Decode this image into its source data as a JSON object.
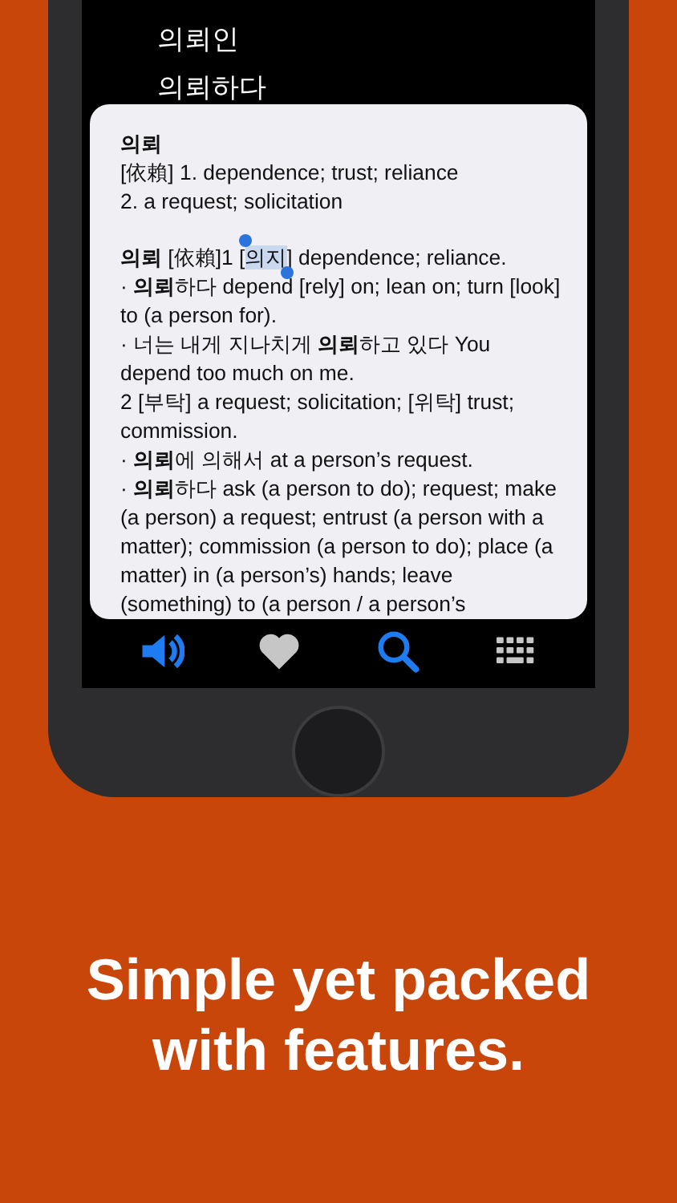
{
  "word_list": [
    {
      "text": "의뢰인"
    },
    {
      "text": "의뢰하다"
    }
  ],
  "popup": {
    "blocks": [
      {
        "lines": [
          {
            "kind": "headword",
            "segments": [
              {
                "text": "의뢰",
                "selected": false
              }
            ]
          },
          {
            "kind": "definition",
            "segments": [
              {
                "text": "[依賴] 1. dependence; trust; reliance",
                "selected": false
              }
            ]
          },
          {
            "kind": "definition",
            "segments": [
              {
                "text": "2. a request; solicitation",
                "selected": false
              }
            ]
          }
        ]
      },
      {
        "lines": [
          {
            "kind": "definition",
            "segments": [
              {
                "text": "**의뢰** [依賴]1 [",
                "selected": false
              },
              {
                "text": "의지",
                "selected": true
              },
              {
                "text": "] dependence; reliance.",
                "selected": false
              }
            ]
          },
          {
            "kind": "example",
            "segments": [
              {
                "text": "· **의뢰**하다 depend [rely] on; lean on; turn [look] to (a person for).",
                "selected": false
              }
            ]
          },
          {
            "kind": "example",
            "segments": [
              {
                "text": "· 너는 내게 지나치게 **의뢰**하고 있다 You depend too much on me.",
                "selected": false
              }
            ]
          },
          {
            "kind": "definition",
            "segments": [
              {
                "text": "2 [부탁] a request; solicitation; [위탁] trust; commission.",
                "selected": false
              }
            ]
          },
          {
            "kind": "example",
            "segments": [
              {
                "text": "· **의뢰**에 의해서 at a person’s request.",
                "selected": false
              }
            ]
          },
          {
            "kind": "example",
            "segments": [
              {
                "text": "· **의뢰**하다 ask (a person to do); request; make (a person) a request; entrust (a person with a matter); commission (a person to do); place (a matter) in (a person’s) hands; leave (something) to (a person / a person’s",
                "selected": false
              }
            ]
          }
        ]
      }
    ]
  },
  "speak_button": {
    "enabled": true
  },
  "tab_bar": [
    {
      "kind": "favorites",
      "selected": false
    },
    {
      "kind": "search",
      "selected": true
    },
    {
      "kind": "keyboard",
      "selected": false
    }
  ],
  "caption": "Simple yet packed with features."
}
